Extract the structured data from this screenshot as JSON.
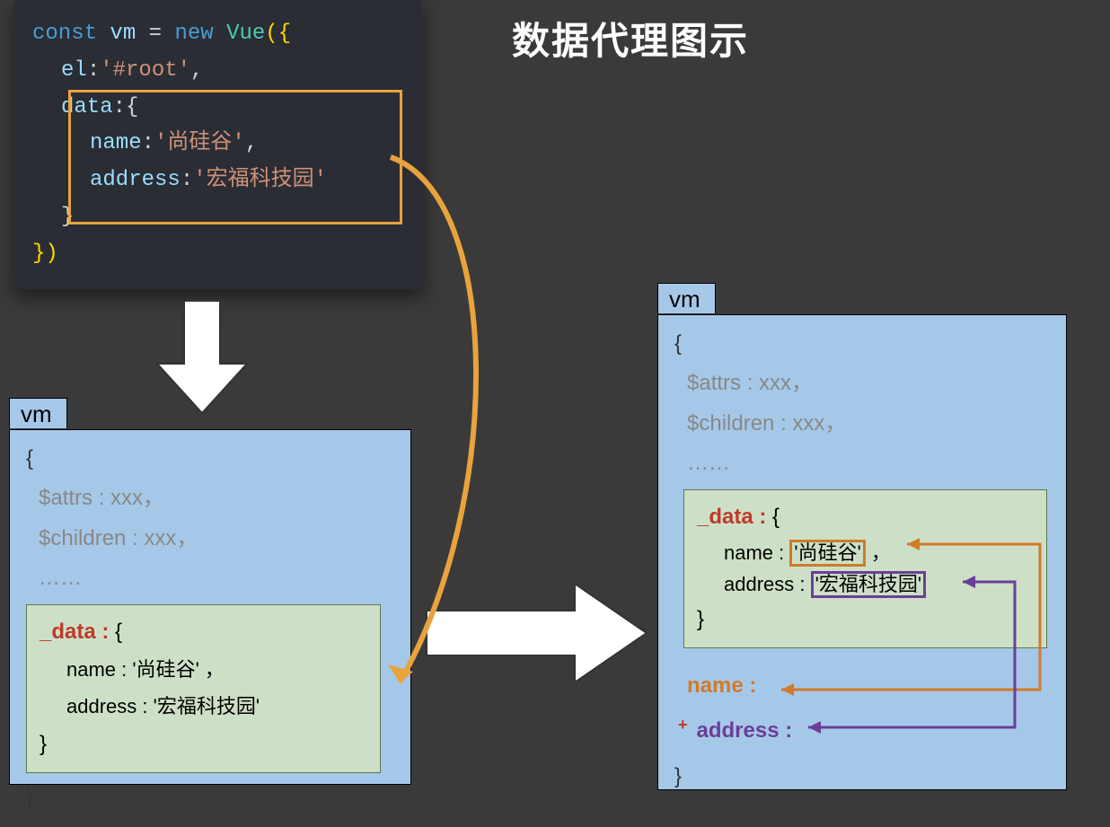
{
  "title": "数据代理图示",
  "code": {
    "const": "const",
    "vm": "vm",
    "eq": "=",
    "new": "new",
    "Vue": "Vue",
    "lparen": "({",
    "el_key": "el",
    "el_val": "'#root'",
    "data_key": "data",
    "name_key": "name",
    "name_val": "'尚硅谷'",
    "address_key": "address",
    "address_val": "'宏福科技园'",
    "rparen": "})"
  },
  "vm_label": "vm",
  "block": {
    "open": "{",
    "close": "}",
    "attrs": "$attrs : xxx，",
    "children": "$children : xxx，",
    "ellipsis": "……",
    "data_key": "_data :",
    "data_open": "{",
    "data_close": "}",
    "name_line_key": "name :",
    "name_line_val": "'尚硅谷'",
    "name_line_comma": "，",
    "address_line_key": "address :",
    "address_line_val": "'宏福科技园'"
  },
  "proxy": {
    "name_label": "name :",
    "address_label": "address :",
    "plus": "+"
  },
  "colors": {
    "orange": "#d17a2a",
    "purple": "#6b3e99",
    "red": "#c0392b",
    "box_bg": "#a6c8e8",
    "data_bg": "#cde0c7"
  }
}
